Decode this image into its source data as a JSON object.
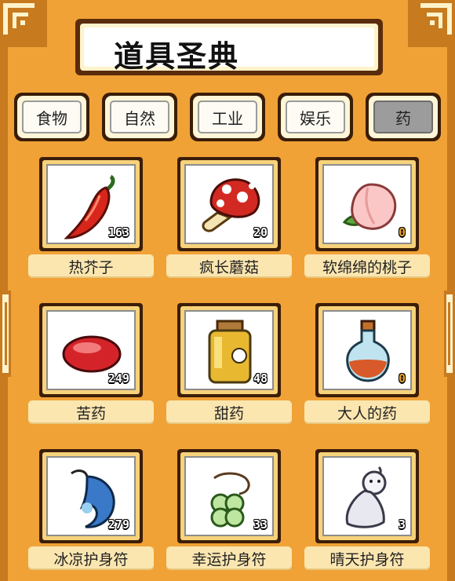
{
  "title": "道具圣典",
  "tabs": [
    {
      "label": "食物",
      "active": false
    },
    {
      "label": "自然",
      "active": false
    },
    {
      "label": "工业",
      "active": false
    },
    {
      "label": "娱乐",
      "active": false
    },
    {
      "label": "药",
      "active": true
    }
  ],
  "items": [
    {
      "name": "热芥子",
      "count": "163",
      "icon": "red-pepper-icon"
    },
    {
      "name": "疯长蘑菇",
      "count": "20",
      "icon": "mushroom-icon"
    },
    {
      "name": "软绵绵的桃子",
      "count": "0",
      "icon": "peach-icon"
    },
    {
      "name": "苦药",
      "count": "249",
      "icon": "red-pill-icon"
    },
    {
      "name": "甜药",
      "count": "48",
      "icon": "honey-jar-icon"
    },
    {
      "name": "大人的药",
      "count": "0",
      "icon": "potion-bottle-icon"
    },
    {
      "name": "冰凉护身符",
      "count": "279",
      "icon": "blue-charm-icon"
    },
    {
      "name": "幸运护身符",
      "count": "33",
      "icon": "clover-charm-icon"
    },
    {
      "name": "晴天护身符",
      "count": "3",
      "icon": "teru-teru-bozu-icon"
    }
  ],
  "colors": {
    "background": "#f0a236",
    "frame": "#c77a1e",
    "label_bg": "#fbe6b0",
    "active_tab": "#9c9c9c"
  }
}
